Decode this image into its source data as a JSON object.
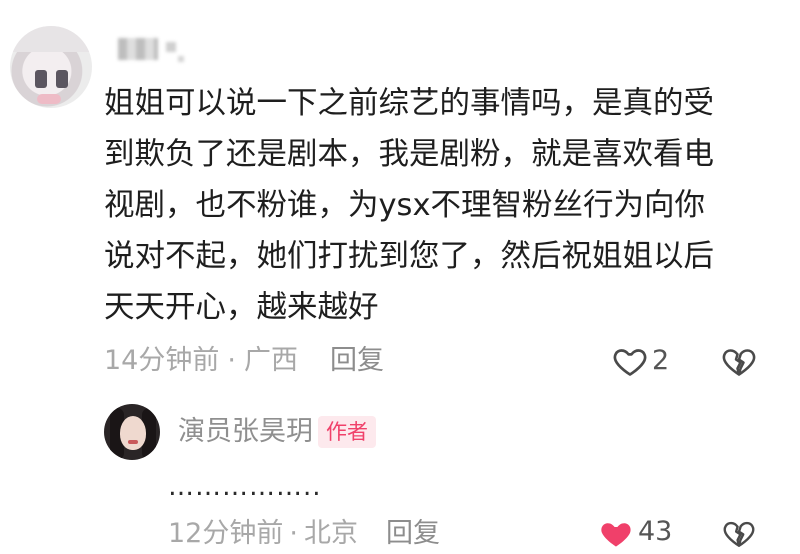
{
  "comment": {
    "lines": [
      "姐姐可以说一下之前综艺的事情吗，是真的受",
      "到欺负了还是剧本，我是剧粉，就是喜欢看电",
      "视剧，也不粉谁，为ysx不理智粉丝行为向你",
      "说对不起，她们打扰到您了，然后祝姐姐以后",
      "天天开心，越来越好"
    ],
    "time": "14分钟前",
    "location": "广西",
    "reply_label": "回复",
    "like_count": "2"
  },
  "reply": {
    "author": "演员张昊玥",
    "badge": "作者",
    "text": "……………..",
    "time": "12分钟前",
    "location": "北京",
    "reply_label": "回复",
    "like_count": "43"
  },
  "colors": {
    "like_active": "#f0406a",
    "badge_bg": "#fde9ed",
    "meta_text": "#a8a8a8"
  },
  "icons": [
    "heart-outline-icon",
    "broken-heart-icon",
    "heart-filled-icon"
  ]
}
